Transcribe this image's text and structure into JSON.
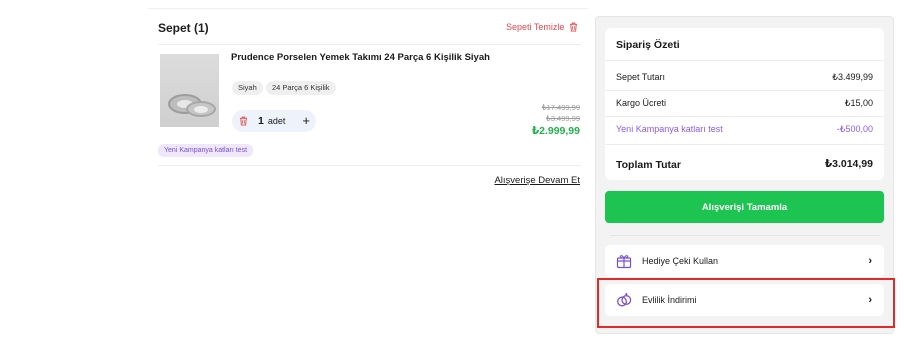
{
  "cart": {
    "title": "Sepet (1)",
    "clear_label": "Sepeti Temizle",
    "item": {
      "name": "Prudence Porselen Yemek Takımı 24 Parça 6 Kişilik Siyah",
      "tags": [
        "Siyah",
        "24 Parça 6 Kişilik"
      ],
      "quantity": "1",
      "quantity_unit": "adet",
      "price_list": "₺17.499,99",
      "price_old": "₺3.499,99",
      "price_new": "₺2.999,99",
      "campaign": "Yeni Kampanya katları test"
    },
    "continue_label": "Alışverişe Devam Et"
  },
  "summary": {
    "title": "Sipariş Özeti",
    "rows": [
      {
        "label": "Sepet Tutarı",
        "value": "₺3.499,99"
      },
      {
        "label": "Kargo Ücreti",
        "value": "₺15,00"
      },
      {
        "label": "Yeni Kampanya katları test",
        "value": "-₺500,00"
      }
    ],
    "total_label": "Toplam Tutar",
    "total_value": "₺3.014,99",
    "checkout_label": "Alışverişi Tamamla",
    "options": [
      {
        "label": "Hediye Çeki Kullan",
        "icon": "gift-icon"
      },
      {
        "label": "Evlilik İndirimi",
        "icon": "rings-icon"
      }
    ]
  },
  "colors": {
    "accent_green": "#1ec452",
    "price_green": "#22b04b",
    "danger_red": "#e5484d",
    "campaign_purple": "#8a5cf0",
    "highlight_red": "#e12a2a"
  }
}
